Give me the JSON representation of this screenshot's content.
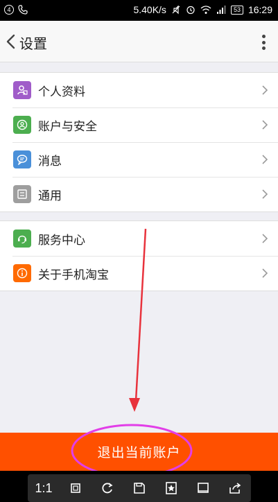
{
  "status_bar": {
    "left_badge": "4",
    "speed": "5.40K/s",
    "battery": "53",
    "time": "16:29"
  },
  "header": {
    "title": "设置"
  },
  "menu_group_1": [
    {
      "label": "个人资料",
      "icon": "profile-icon",
      "color": "#a05cc9"
    },
    {
      "label": "账户与安全",
      "icon": "account-security-icon",
      "color": "#4cae4f"
    },
    {
      "label": "消息",
      "icon": "message-icon",
      "color": "#4a90d9"
    },
    {
      "label": "通用",
      "icon": "general-icon",
      "color": "#9e9e9e"
    }
  ],
  "menu_group_2": [
    {
      "label": "服务中心",
      "icon": "service-center-icon",
      "color": "#4cae4f"
    },
    {
      "label": "关于手机淘宝",
      "icon": "about-icon",
      "color": "#ff6a00"
    }
  ],
  "logout": {
    "label": "退出当前账户",
    "color": "#ff5000"
  },
  "toolbar": {
    "ratio_label": "1:1"
  }
}
